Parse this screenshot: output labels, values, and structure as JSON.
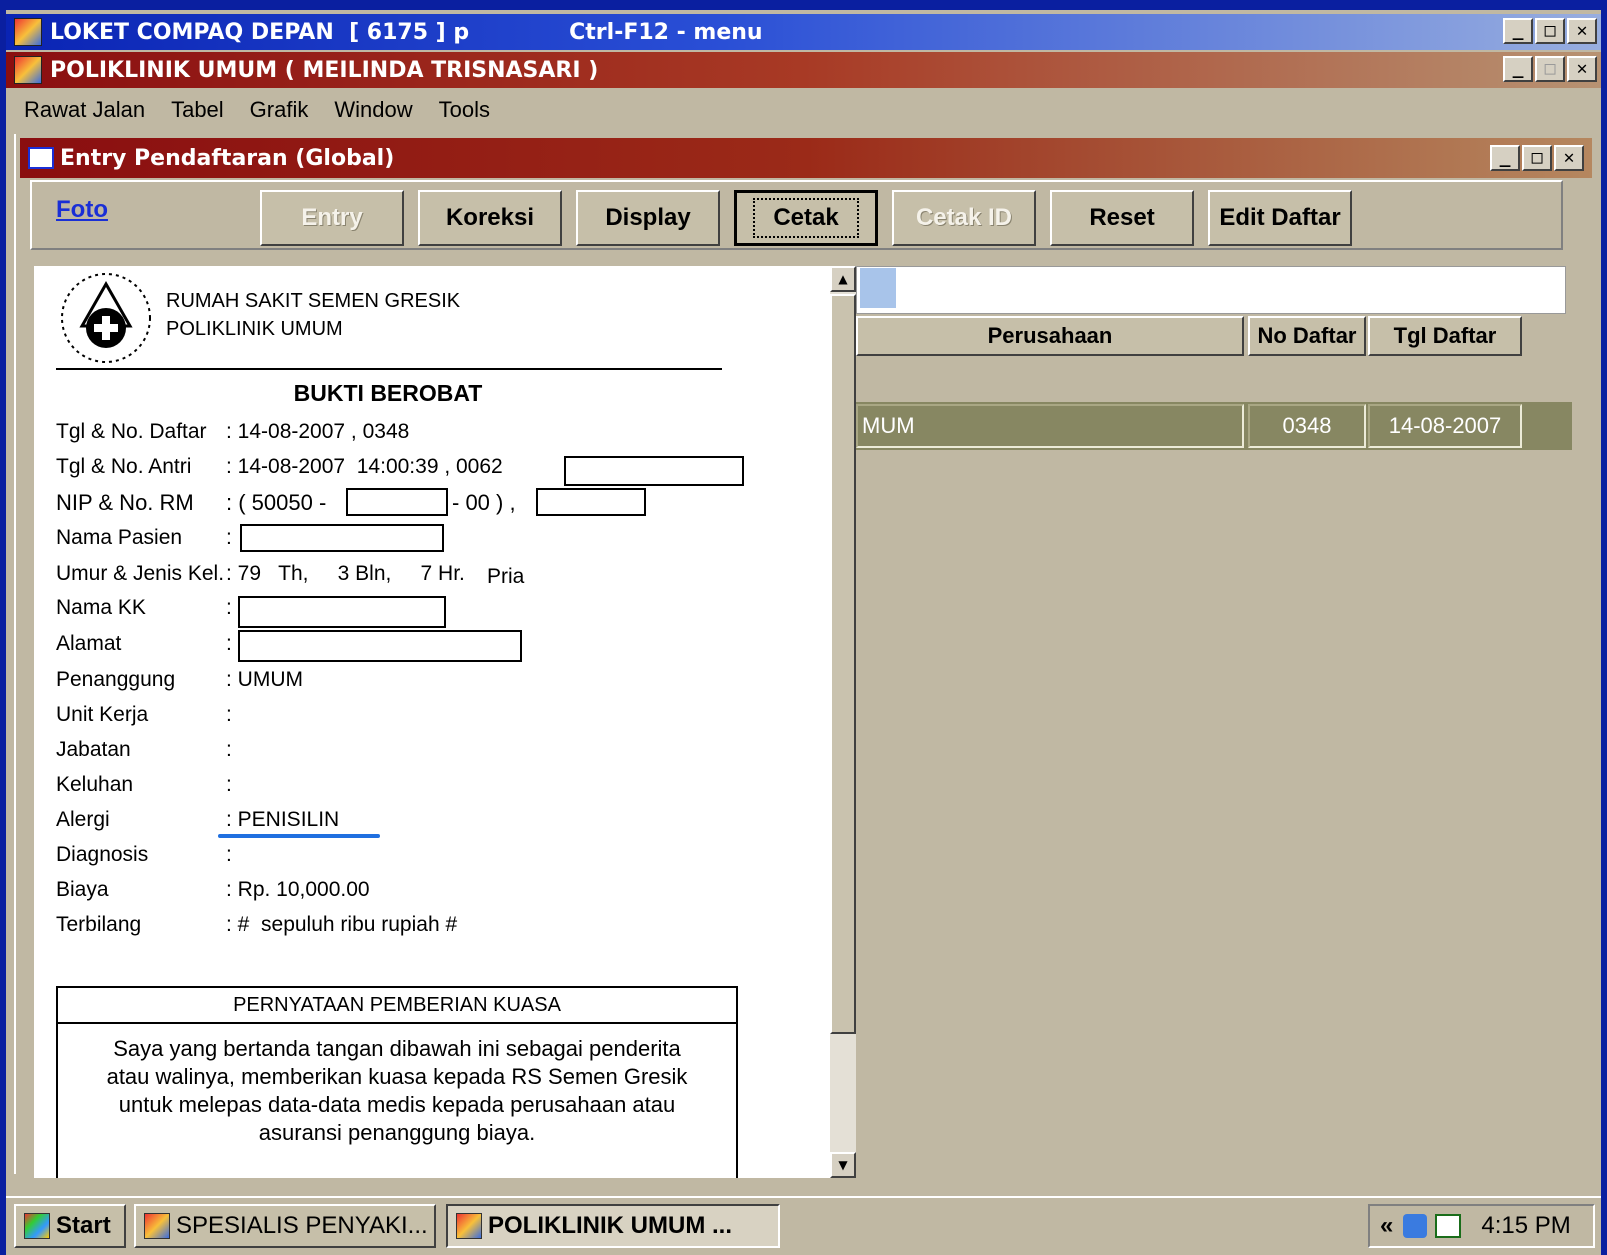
{
  "titlebar": {
    "title": "LOKET COMPAQ DEPAN  [ 6175 ] p",
    "shortcut": "Ctrl-F12 - menu"
  },
  "app_window": {
    "title": "POLIKLINIK UMUM ( MEILINDA TRISNASARI )"
  },
  "menu": [
    "Rawat Jalan",
    "Tabel",
    "Grafik",
    "Window",
    "Tools"
  ],
  "child_window": {
    "title": "Entry Pendaftaran (Global)"
  },
  "window_controls": {
    "minimize": "_",
    "maximize": "□",
    "close": "✕"
  },
  "toolbar": {
    "foto": "Foto",
    "buttons": [
      "Entry",
      "Koreksi",
      "Display",
      "Cetak",
      "Cetak ID",
      "Reset",
      "Edit Daftar"
    ]
  },
  "receipt": {
    "hospital": "RUMAH SAKIT SEMEN GRESIK",
    "clinic": "POLIKLINIK UMUM",
    "heading": "BUKTI BEROBAT",
    "fields": [
      {
        "label": "Tgl & No. Daftar",
        "value": ": 14-08-2007 , 0348"
      },
      {
        "label": "Tgl & No. Antri",
        "value": ": 14-08-2007  14:00:39 , 0062"
      },
      {
        "label": "NIP & No. RM",
        "value": ": ( 50050 -",
        "value2": "- 00 ) ,"
      },
      {
        "label": "Nama Pasien",
        "value": ":"
      },
      {
        "label": "Umur & Jenis Kel.",
        "value": ": 79   Th,     3 Bln,     7 Hr.",
        "value2": "Pria"
      },
      {
        "label": "Nama KK",
        "value": ":"
      },
      {
        "label": "Alamat",
        "value": ":"
      },
      {
        "label": "Penanggung",
        "value": ": UMUM"
      },
      {
        "label": "Unit Kerja",
        "value": ":"
      },
      {
        "label": "Jabatan",
        "value": ":"
      },
      {
        "label": "Keluhan",
        "value": ":"
      },
      {
        "label": "Alergi",
        "value": ": PENISILIN"
      },
      {
        "label": "Diagnosis",
        "value": ":"
      },
      {
        "label": "Biaya",
        "value": ": Rp. 10,000.00"
      },
      {
        "label": "Terbilang",
        "value": ": #  sepuluh ribu rupiah #"
      }
    ],
    "statement_title": "PERNYATAAN PEMBERIAN KUASA",
    "statement_lines": [
      "Saya yang bertanda tangan dibawah ini sebagai penderita",
      "atau walinya, memberikan kuasa kepada RS Semen Gresik",
      "untuk melepas data-data medis kepada perusahaan atau",
      "asuransi penanggung biaya."
    ]
  },
  "grid": {
    "columns": [
      "Perusahaan",
      "No Daftar",
      "Tgl Daftar"
    ],
    "row": {
      "perusahaan": "MUM",
      "no_daftar": "0348",
      "tgl_daftar": "14-08-2007"
    }
  },
  "taskbar": {
    "start": "Start",
    "tasks": [
      "SPESIALIS PENYAKI...",
      "POLIKLINIK UMUM ..."
    ],
    "tray_chevron": "«",
    "time": "4:15 PM"
  },
  "colors": {
    "title_blue": "#0a24b4",
    "title_red": "#8a0e10",
    "row_selected": "#878762",
    "link": "#1a2fd6"
  }
}
